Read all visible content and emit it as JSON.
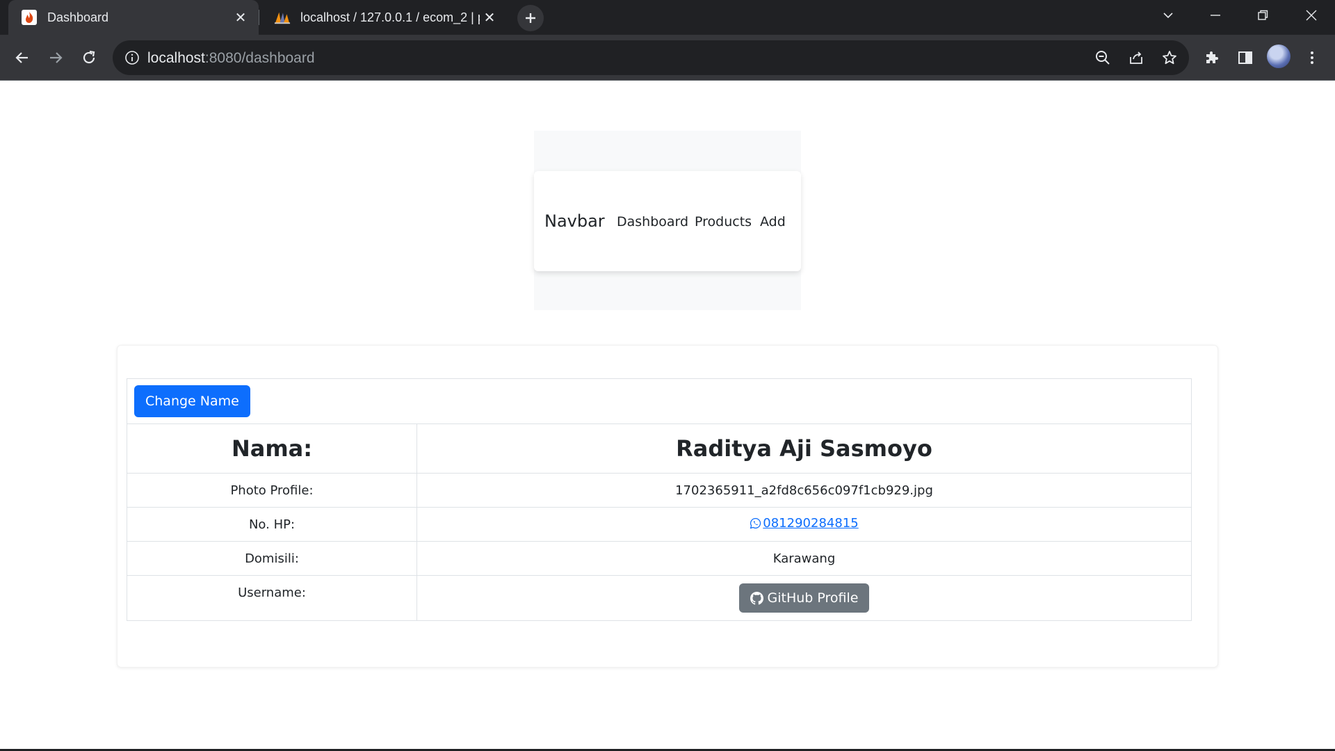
{
  "browser": {
    "tabs": [
      {
        "title": "Dashboard",
        "favicon": "codeigniter-flame-icon",
        "active": true
      },
      {
        "title": "localhost / 127.0.0.1 / ecom_2 | p",
        "favicon": "phpmyadmin-sail-icon",
        "active": false
      }
    ],
    "url_host": "localhost",
    "url_rest": ":8080/dashboard"
  },
  "navbar": {
    "brand": "Navbar",
    "links": [
      "Dashboard",
      "Products",
      "Add"
    ]
  },
  "profile": {
    "change_name_label": "Change Name",
    "name_label": "Nama:",
    "name_value": "Raditya Aji Sasmoyo",
    "photo_label": "Photo Profile:",
    "photo_value": "1702365911_a2fd8c656c097f1cb929.jpg",
    "phone_label": "No. HP:",
    "phone_value": "081290284815",
    "domisili_label": "Domisili:",
    "domisili_value": "Karawang",
    "username_label": "Username:",
    "github_label": "GitHub Profile"
  },
  "colors": {
    "primary": "#0d6efd",
    "secondary": "#6c757d",
    "chrome_dark": "#202124",
    "chrome_toolbar": "#35363a"
  }
}
